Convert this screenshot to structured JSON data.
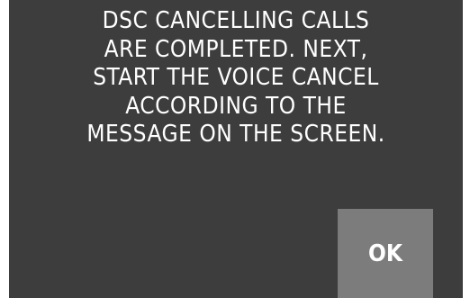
{
  "dialog": {
    "message_lines": [
      "DSC CANCELLING CALLS",
      "ARE COMPLETED. NEXT,",
      "START THE VOICE CANCEL",
      "ACCORDING TO THE",
      "MESSAGE ON THE SCREEN."
    ],
    "ok_label": "OK"
  },
  "colors": {
    "screen_background": "#3d3d3d",
    "button_background": "#7c7c7c",
    "text": "#ffffff"
  }
}
